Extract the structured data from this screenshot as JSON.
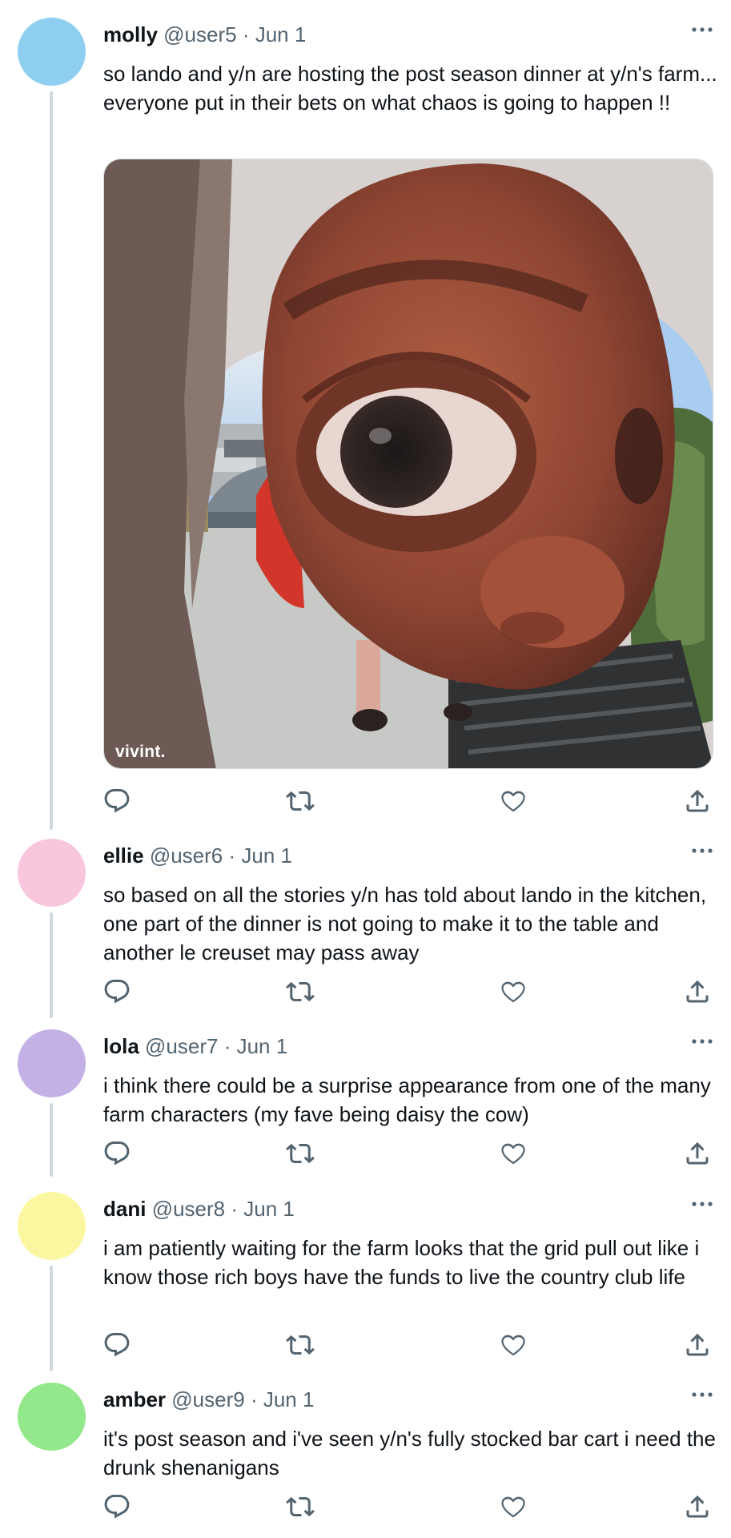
{
  "colors": {
    "text_primary": "#0f1419",
    "text_secondary": "#536471",
    "icon": "#536471",
    "thread_line": "#cfd9de"
  },
  "icons": {
    "more": "more-horizontal-icon",
    "reply": "reply-icon",
    "retweet": "retweet-icon",
    "like": "heart-icon",
    "share": "share-icon"
  },
  "tweets": [
    {
      "name": "molly",
      "handle": "@user5",
      "separator": " · ",
      "date": "Jun 1",
      "avatar_color": "#8ecff1",
      "text": "so lando and y/n are hosting the post season dinner at y/n's farm... everyone put in their bets on what chaos is going to happen !!",
      "media": {
        "watermark": "vivint."
      }
    },
    {
      "name": "ellie",
      "handle": "@user6",
      "separator": " · ",
      "date": "Jun 1",
      "avatar_color": "#f8c6dd",
      "text": "so based on all the stories y/n has told about lando in the kitchen, one part of the dinner is not going to make it to the table and another le creuset may pass away"
    },
    {
      "name": "lola",
      "handle": "@user7",
      "separator": " · ",
      "date": "Jun 1",
      "avatar_color": "#c3b1e6",
      "text": "i think there could be a surprise appearance from one of the many farm characters (my fave being daisy the cow)"
    },
    {
      "name": "dani",
      "handle": "@user8",
      "separator": " · ",
      "date": "Jun 1",
      "avatar_color": "#fbf7a0",
      "text": "i am patiently waiting for the farm looks that the grid pull out like i know those rich boys have the funds to live the country club life"
    },
    {
      "name": "amber",
      "handle": "@user9",
      "separator": " · ",
      "date": "Jun 1",
      "avatar_color": "#93e88b",
      "text": "it's post season and i've seen y/n's fully stocked bar cart i need the drunk shenanigans"
    }
  ]
}
